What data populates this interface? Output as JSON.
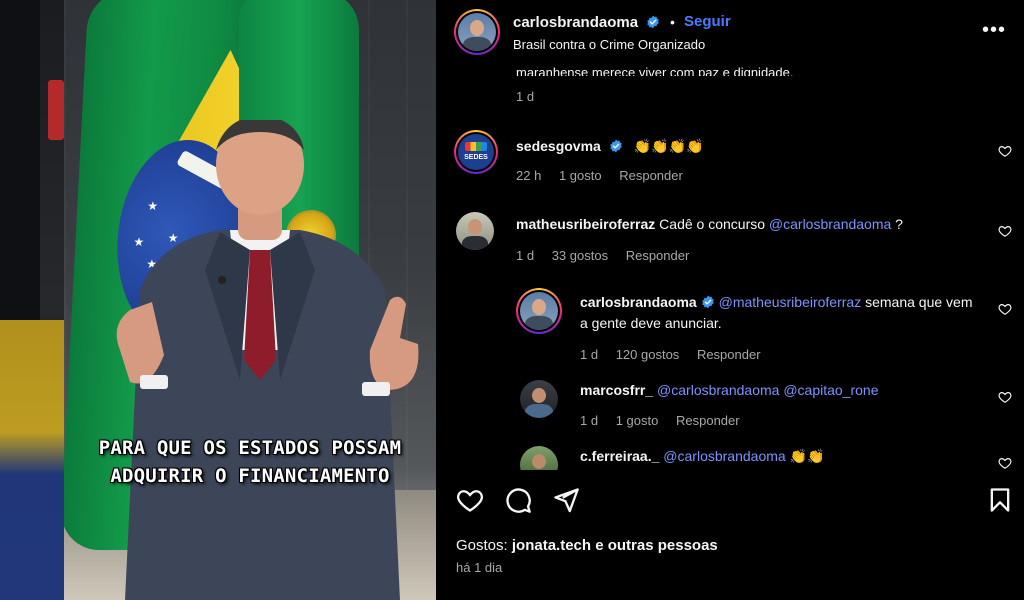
{
  "video": {
    "caption_line1": "PARA QUE OS ESTADOS POSSAM",
    "caption_line2": "ADQUIRIR O FINANCIAMENTO"
  },
  "header": {
    "username": "carlosbrandaoma",
    "separator": "•",
    "follow_label": "Seguir",
    "subtitle": "Brasil contra o Crime Organizado",
    "more_label": "•••"
  },
  "truncated_comment": {
    "text": "maranhense merece viver com paz e dignidade.",
    "time": "1 d"
  },
  "comments": [
    {
      "username": "sedesgovma",
      "text": "👏👏👏👏",
      "time": "22 h",
      "likes": "1 gosto",
      "reply": "Responder"
    },
    {
      "username": "matheusribeiroferraz",
      "text_before": "Cadê o concurso ",
      "mention": "@carlosbrandaoma",
      "text_after": " ?",
      "time": "1 d",
      "likes": "33 gostos",
      "reply": "Responder"
    },
    {
      "username": "carlosbrandaoma",
      "mention": "@matheusribeiroferraz",
      "text_after": " semana que vem a gente deve anunciar.",
      "time": "1 d",
      "likes": "120 gostos",
      "reply": "Responder"
    },
    {
      "username": "marcosfrr_",
      "mention1": "@carlosbrandaoma",
      "mention2": "@capitao_rone",
      "time": "1 d",
      "likes": "1 gosto",
      "reply": "Responder"
    },
    {
      "username": "c.ferreiraa._",
      "mention": "@carlosbrandaoma",
      "text_after": " 👏👏"
    }
  ],
  "footer": {
    "likes_prefix": "Gostos: ",
    "likes_user": "jonata.tech",
    "likes_suffix": " e outras pessoas",
    "time": "há 1 dia"
  },
  "icons": {
    "like": "heart-icon",
    "comment": "comment-icon",
    "share": "send-icon",
    "save": "bookmark-icon",
    "verified": "verified-badge-icon",
    "more": "more-options-icon"
  },
  "colors": {
    "accent": "#4a7bff",
    "mention": "#7c93ff",
    "muted": "#a8a8a8",
    "verified": "#3897f0"
  }
}
